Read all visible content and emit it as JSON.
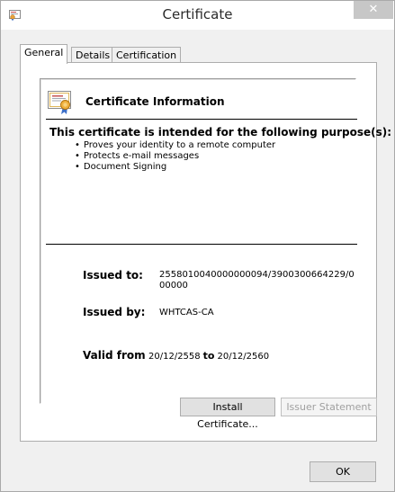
{
  "window": {
    "title": "Certificate",
    "close_glyph": "✕"
  },
  "tabs": [
    {
      "label": "General",
      "active": true
    },
    {
      "label": "Details",
      "active": false
    },
    {
      "label": "Certification Path",
      "active": false
    }
  ],
  "info": {
    "title": "Certificate Information",
    "purpose_title": "This certificate is intended for the following purpose(s):",
    "purposes": [
      "Proves your identity to a remote computer",
      "Protects e-mail messages",
      "Document Signing"
    ],
    "issued_to_label": "Issued to:",
    "issued_to_value": "2558010040000000094/3900300664229/000000",
    "issued_by_label": "Issued by:",
    "issued_by_value": "WHTCAS-CA",
    "valid_from_label": "Valid from",
    "valid_from_value": "20/12/2558",
    "valid_to_word": "to",
    "valid_to_value": "20/12/2560"
  },
  "buttons": {
    "install": "Install Certificate...",
    "issuer": "Issuer Statement",
    "ok": "OK"
  },
  "icons": {
    "title_icon": "certificate-icon",
    "info_icon": "certificate-ribbon-icon"
  },
  "colors": {
    "window_bg": "#f0f0f0",
    "close_button_bg": "#c7c7c7"
  }
}
